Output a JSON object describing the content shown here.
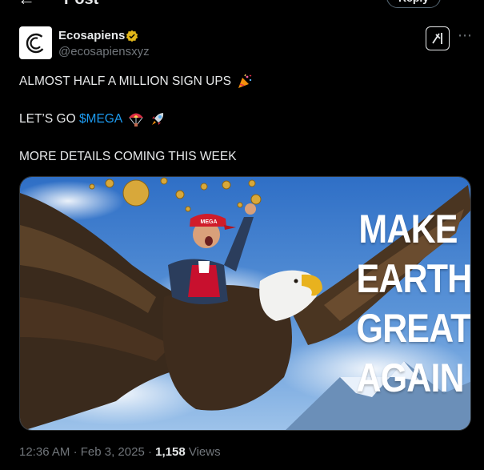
{
  "header": {
    "title": "Post",
    "reply_label": "Reply"
  },
  "post": {
    "author": {
      "name": "Ecosapiens",
      "handle": "@ecosapiensxyz",
      "verified": true
    },
    "lines": {
      "line1": "ALMOST HALF A MILLION SIGN UPS",
      "line2_prefix": "LET’S GO ",
      "cashtag": "$MEGA",
      "line3": "MORE DETAILS COMING THIS WEEK"
    },
    "image": {
      "cap_text": "MEGA",
      "slogan": [
        "MAKE",
        "EARTH",
        "GREAT",
        "AGAIN"
      ]
    },
    "meta": {
      "time": "12:36 AM",
      "separator": "·",
      "date": "Feb 3, 2025",
      "views_count": "1,158",
      "views_label": "Views"
    }
  },
  "colors": {
    "background": "#000000",
    "text": "#e7e9ea",
    "secondary": "#71767b",
    "link": "#1d9bf0",
    "verified": "#e2b719"
  },
  "icons": [
    "back-arrow-icon",
    "verified-badge-icon",
    "grok-icon",
    "more-icon",
    "party-popper-icon",
    "parachute-icon",
    "rocket-icon"
  ]
}
